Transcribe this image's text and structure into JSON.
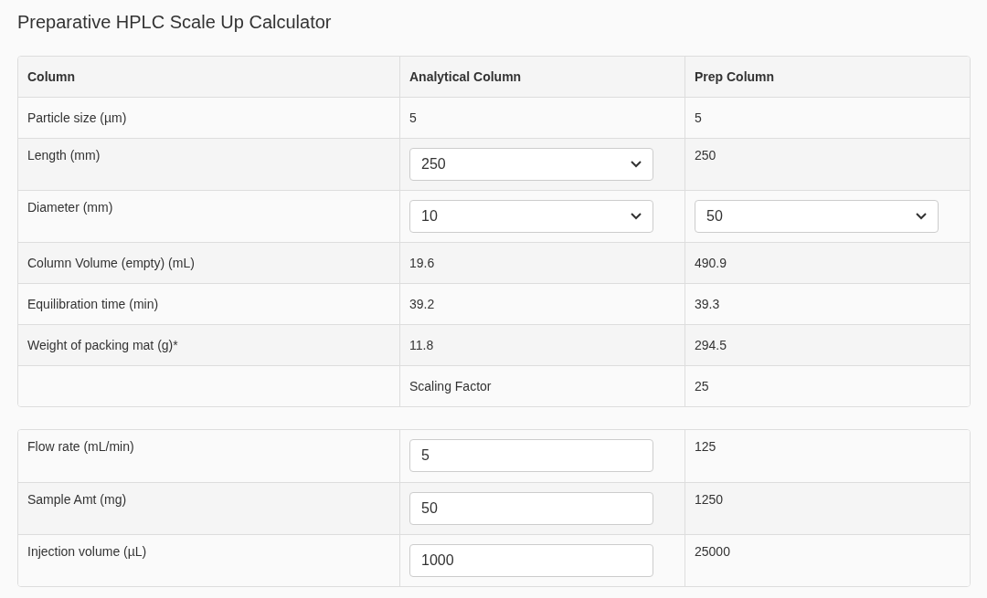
{
  "title": "Preparative HPLC Scale Up Calculator",
  "column_table": {
    "columns": [
      "Column",
      "Analytical Column",
      "Prep Column"
    ],
    "rows": [
      {
        "cells": [
          {
            "kind": "text",
            "text": "Particle size (µm)"
          },
          {
            "kind": "text",
            "text": "5"
          },
          {
            "kind": "text",
            "text": "5"
          }
        ]
      },
      {
        "cells": [
          {
            "kind": "text",
            "text": "Length (mm)"
          },
          {
            "kind": "select",
            "value": "250"
          },
          {
            "kind": "text",
            "text": "250"
          }
        ]
      },
      {
        "cells": [
          {
            "kind": "text",
            "text": "Diameter (mm)"
          },
          {
            "kind": "select",
            "value": "10"
          },
          {
            "kind": "select",
            "value": "50"
          }
        ]
      },
      {
        "cells": [
          {
            "kind": "text",
            "text": "Column Volume (empty) (mL)"
          },
          {
            "kind": "text",
            "text": "19.6"
          },
          {
            "kind": "text",
            "text": "490.9"
          }
        ]
      },
      {
        "cells": [
          {
            "kind": "text",
            "text": "Equilibration time (min)"
          },
          {
            "kind": "text",
            "text": "39.2"
          },
          {
            "kind": "text",
            "text": "39.3"
          }
        ]
      },
      {
        "cells": [
          {
            "kind": "text",
            "text": "Weight of packing mat (g)*"
          },
          {
            "kind": "text",
            "text": "11.8"
          },
          {
            "kind": "text",
            "text": "294.5"
          }
        ]
      },
      {
        "cells": [
          {
            "kind": "text",
            "text": ""
          },
          {
            "kind": "text",
            "text": "Scaling Factor"
          },
          {
            "kind": "text",
            "text": "25"
          }
        ]
      }
    ]
  },
  "flow_table": {
    "rows": [
      {
        "cells": [
          {
            "kind": "text",
            "text": "Flow rate (mL/min)"
          },
          {
            "kind": "input",
            "value": "5"
          },
          {
            "kind": "text",
            "text": "125"
          }
        ]
      },
      {
        "cells": [
          {
            "kind": "text",
            "text": "Sample Amt (mg)"
          },
          {
            "kind": "input",
            "value": "50"
          },
          {
            "kind": "text",
            "text": "1250"
          }
        ]
      },
      {
        "cells": [
          {
            "kind": "text",
            "text": "Injection volume (µL)"
          },
          {
            "kind": "input",
            "value": "1000"
          },
          {
            "kind": "text",
            "text": "25000"
          }
        ]
      }
    ]
  }
}
